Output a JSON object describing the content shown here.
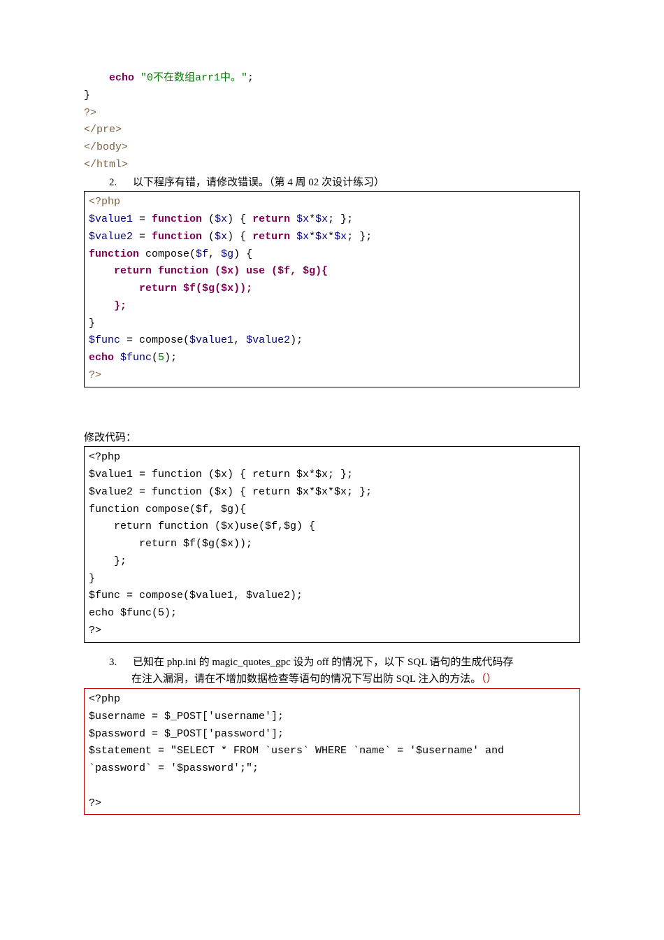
{
  "block1": {
    "l1a": "    ",
    "l1b": "echo ",
    "l1c": "\"0不在数组arr1中。\"",
    "l1d": ";",
    "l2": "}",
    "l3": "?>",
    "l4": "</pre>",
    "l5": "</body>",
    "l6": "</html>"
  },
  "q2": {
    "num": "2.",
    "text": "以下程序有错，请修改错误。（第 4 周 02 次设计练习）"
  },
  "block2": {
    "l1": "<?php",
    "l2_v": "$value1",
    "l2_a": " = ",
    "l2_k1": "function ",
    "l2_b": "(",
    "l2_x": "$x",
    "l2_c": ") { ",
    "l2_k2": "return ",
    "l2_d": "*",
    "l2_e": "; };",
    "l3_v": "$value2",
    "l4_k": "function ",
    "l4_f": "compose(",
    "l4_p1": "$f",
    "l4_c": ", ",
    "l4_p2": "$g",
    "l4_e": ") {",
    "l5a": "    ",
    "l5k1": "return function ",
    "l5b": "(",
    "l5x": "$x",
    "l5c": ") ",
    "l5k2": "use ",
    "l5d": "(",
    "l5f": "$f",
    "l5cm": ", ",
    "l5g": "$g",
    "l5e": "){",
    "l6a": "        ",
    "l6k": "return ",
    "l6b": "$f",
    "l6c": "(",
    "l6d": "$g",
    "l6e": "(",
    "l6f": "$x",
    "l6g": "));",
    "l7a": "    ",
    "l7b": "};",
    "l8": "}",
    "l9a": "$func",
    "l9b": " = compose(",
    "l9c": "$value1",
    "l9d": ", ",
    "l9e": "$value2",
    "l9f": ");",
    "l10a": "echo ",
    "l10b": "$func",
    "l10c": "(",
    "l10d": "5",
    "l10e": ");",
    "l11": "?>"
  },
  "label_fix": "修改代码：",
  "block3": {
    "l1": "<?php",
    "l2": "$value1 = function ($x) { return $x*$x; };",
    "l3": "$value2 = function ($x) { return $x*$x*$x; };",
    "l4": "function compose($f, $g){",
    "l5": "    return function ($x)use($f,$g) {",
    "l6": "        return $f($g($x));",
    "l7": "    };",
    "l8": "}",
    "l9": "$func = compose($value1, $value2);",
    "l10": "echo $func(5);",
    "l11": "?>"
  },
  "q3": {
    "num": "3.",
    "text1": "已知在 php.ini 的 magic_quotes_gpc 设为 off 的情况下，以下 SQL 语句的生成代码存",
    "text2": "在注入漏洞，请在不增加数据检查等语句的情况下写出防 SQL 注入的方法。",
    "paren": "（）"
  },
  "block4": {
    "l1": "<?php",
    "l2": "$username = $_POST['username'];",
    "l3": "$password = $_POST['password'];",
    "l4": "$statement = \"SELECT * FROM `users` WHERE `name` = '$username' and",
    "l5": "`password` = '$password';\";",
    "blank": "",
    "l6": "?>"
  }
}
